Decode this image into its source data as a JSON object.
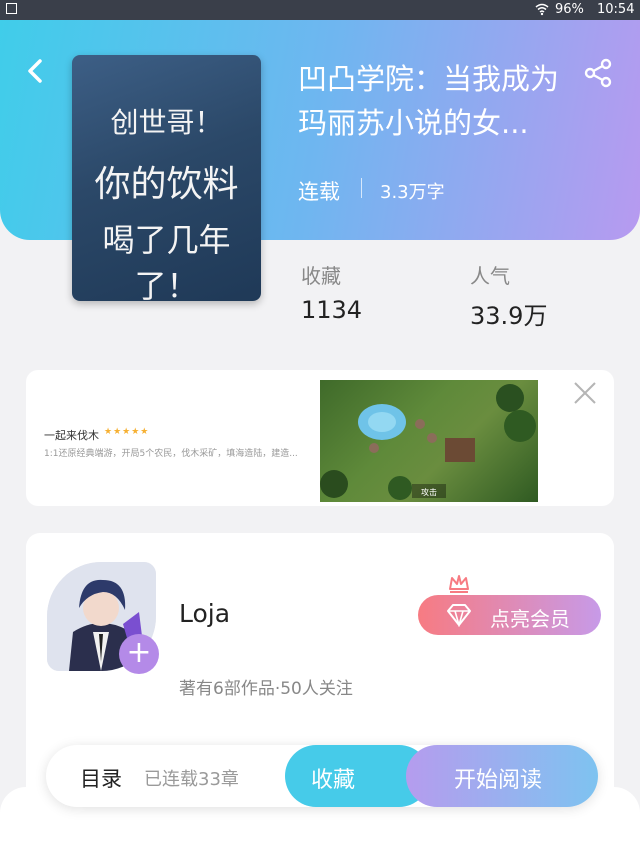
{
  "status_bar": {
    "battery": "96%",
    "time": "10:54"
  },
  "book": {
    "title": "凹凸学院：当我成为玛丽苏小说的女...",
    "status": "连载",
    "word_count": "3.3万字",
    "cover_lines": [
      "创世哥！",
      "你的饮料",
      "喝了几年了！"
    ]
  },
  "stats": {
    "favorites_label": "收藏",
    "favorites_value": "1134",
    "popularity_label": "人气",
    "popularity_value": "33.9万"
  },
  "ad": {
    "title": "一起来伐木",
    "stars": "★★★★★",
    "description": "1:1还原经典端游，开局5个农民，伐木采矿，填海造陆，建造...",
    "image_caption": "攻击"
  },
  "author": {
    "name": "Loja",
    "meta": "著有6部作品·50人关注",
    "vip_label": "点亮会员",
    "follow_symbol": "+"
  },
  "bottom_bar": {
    "toc_label": "目录",
    "chapters": "已连载33章",
    "collect_label": "收藏",
    "read_label": "开始阅读"
  },
  "colors": {
    "header_start": "#40cdea",
    "header_end": "#b79af0",
    "collect_button": "#46cbe9",
    "vip_start": "#f77b82",
    "vip_end": "#c79ae8"
  }
}
